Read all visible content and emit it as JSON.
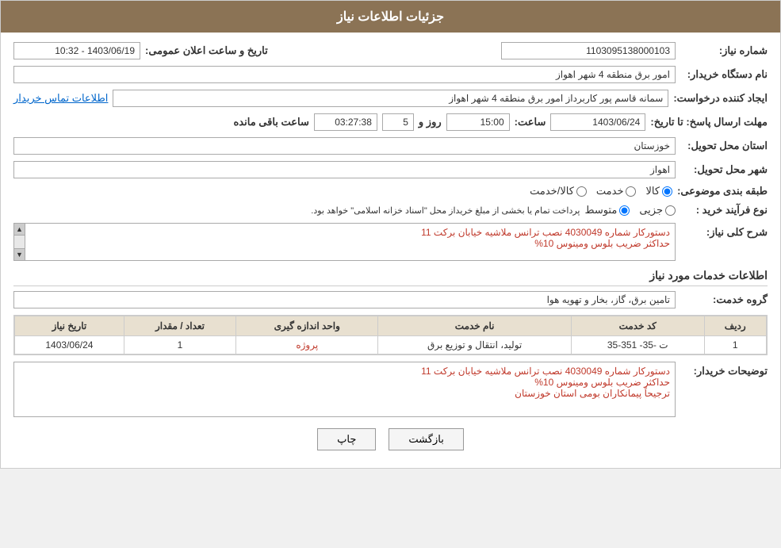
{
  "page": {
    "title": "جزئیات اطلاعات نیاز"
  },
  "fields": {
    "shomareNiaz_label": "شماره نیاز:",
    "shomareNiaz_value": "1103095138000103",
    "tarikhLabel": "تاریخ و ساعت اعلان عمومی:",
    "tarikhValue": "1403/06/19 - 10:32",
    "namDastgahLabel": "نام دستگاه خریدار:",
    "namDastgahValue": "امور برق منطقه 4 شهر اهواز",
    "ijadLabel": "ایجاد کننده درخواست:",
    "ijadValue": "سمانه قاسم پور کاربرداز امور برق منطقه 4 شهر اهواز",
    "ijadLink": "اطلاعات تماس خریدار",
    "mohlat_label": "مهلت ارسال پاسخ: تا تاریخ:",
    "mohlat_date": "1403/06/24",
    "mohlat_saat_label": "ساعت:",
    "mohlat_saat": "15:00",
    "mohlat_rooz_label": "روز و",
    "mohlat_rooz": "5",
    "mohlat_remaining": "03:27:38",
    "mohlat_remaining_label": "ساعت باقی مانده",
    "ostan_label": "استان محل تحویل:",
    "ostan_value": "خوزستان",
    "shahr_label": "شهر محل تحویل:",
    "shahr_value": "اهواز",
    "tabaghebandi_label": "طبقه بندی موضوعی:",
    "radio1": "کالا",
    "radio2": "خدمت",
    "radio3": "کالا/خدمت",
    "radio_selected": "کالا",
    "noeFarayand_label": "نوع فرآیند خرید :",
    "noeFarayand_r1": "جزیی",
    "noeFarayand_r2": "متوسط",
    "noeFarayand_note": "پرداخت تمام یا بخشی از مبلغ خریداز محل \"اسناد خزانه اسلامی\" خواهد بود.",
    "sharhLabel": "شرح کلی نیاز:",
    "sharhValue": "دستورکار شماره 4030049 نصب ترانس ملاشیه خیابان برکت 11\nحداکثر ضریب بلوس ومینوس 10%",
    "khadamat_title": "اطلاعات خدمات مورد نیاز",
    "goroh_label": "گروه خدمت:",
    "goroh_value": "تامین برق، گاز، بخار و تهویه هوا",
    "table": {
      "headers": [
        "ردیف",
        "کد خدمت",
        "نام خدمت",
        "واحد اندازه گیری",
        "تعداد / مقدار",
        "تاریخ نیاز"
      ],
      "rows": [
        {
          "radif": "1",
          "kod": "ت -35- 351-35",
          "name": "تولید، انتقال و توزیع برق",
          "vahed": "پروژه",
          "tedad": "1",
          "tarikh": "1403/06/24"
        }
      ]
    },
    "toozihat_label": "توضیحات خریدار:",
    "toozihat_value": "دستورکار شماره 4030049 نصب ترانس ملاشیه خیابان برکت 11\nحداکثر ضریب بلوس ومینوس 10%\nترجیحاً پیمانکاران بومی استان خوزستان",
    "btn_chap": "چاپ",
    "btn_bazgasht": "بازگشت"
  }
}
